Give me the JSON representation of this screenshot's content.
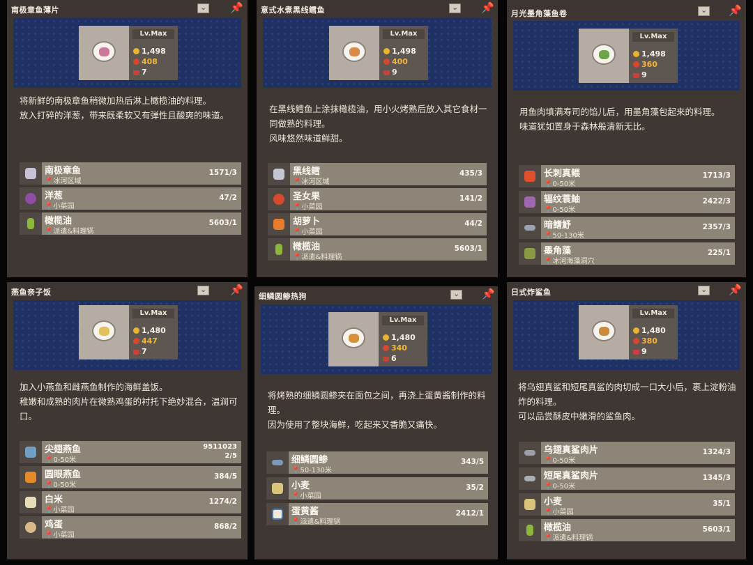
{
  "cards": [
    {
      "title": "南极章鱼薄片",
      "level": "Lv.Max",
      "price": "1,498",
      "score": "408",
      "time": "7",
      "description": "将新鲜的南极章鱼稍微加热后淋上橄榄油的料理。\n放入打碎的洋葱，带来既柔软又有弹性且酸爽的味道。",
      "ingredients": [
        {
          "name": "南极章鱼",
          "location": "冰河区域",
          "count": "1571/3"
        },
        {
          "name": "洋葱",
          "location": "小菜园",
          "count": "47/2"
        },
        {
          "name": "橄榄油",
          "location": "派遣&料理锅",
          "count": "5603/1"
        }
      ]
    },
    {
      "title": "意式水煮黑线鳕鱼",
      "level": "Lv.Max",
      "price": "1,498",
      "score": "400",
      "time": "9",
      "description": "在黑线鳕鱼上涂抹橄榄油，用小火烤熟后放入其它食材一同做熟的料理。\n风味悠然味道鲜甜。",
      "ingredients": [
        {
          "name": "黑线鳕",
          "location": "冰河区域",
          "count": "435/3"
        },
        {
          "name": "圣女果",
          "location": "小菜园",
          "count": "141/2"
        },
        {
          "name": "胡萝卜",
          "location": "小菜园",
          "count": "44/2"
        },
        {
          "name": "橄榄油",
          "location": "派遣&料理锅",
          "count": "5603/1"
        }
      ]
    },
    {
      "title": "月光墨角藻鱼卷",
      "level": "Lv.Max",
      "price": "1,498",
      "score": "360",
      "time": "9",
      "description": "用鱼肉填满寿司的馅儿后，用墨角藻包起来的料理。\n味道犹如置身于森林般清新无比。",
      "ingredients": [
        {
          "name": "长刺真鳂",
          "location": "0-50米",
          "count": "1713/3"
        },
        {
          "name": "辐纹蓑鲉",
          "location": "0-50米",
          "count": "2422/3"
        },
        {
          "name": "暗鳍魣",
          "location": "50-130米",
          "count": "2357/3"
        },
        {
          "name": "墨角藻",
          "location": "冰河海藻洞穴",
          "count": "225/1"
        }
      ]
    },
    {
      "title": "燕鱼亲子饭",
      "level": "Lv.Max",
      "price": "1,480",
      "score": "447",
      "time": "7",
      "description": "加入小燕鱼和雌燕鱼制作的海鲜盖饭。\n稚嫩和成熟的肉片在微熟鸡蛋的衬托下绝妙混合，温润可口。",
      "ingredients": [
        {
          "name": "尖翅燕鱼",
          "location": "0-50米",
          "count": "95110232/5"
        },
        {
          "name": "圆眼燕鱼",
          "location": "0-50米",
          "count": "384/5"
        },
        {
          "name": "白米",
          "location": "小菜园",
          "count": "1274/2"
        },
        {
          "name": "鸡蛋",
          "location": "小菜园",
          "count": "868/2"
        }
      ]
    },
    {
      "title": "细鳞圆鲹热狗",
      "level": "Lv.Max",
      "price": "1,480",
      "score": "340",
      "time": "6",
      "description": "将烤熟的细鳞圆鲹夹在面包之间，再浇上蛋黄酱制作的料理。\n因为使用了整块海鲜，吃起来又香脆又痛快。",
      "ingredients": [
        {
          "name": "细鳞圆鲹",
          "location": "50-130米",
          "count": "343/5"
        },
        {
          "name": "小麦",
          "location": "小菜园",
          "count": "35/2"
        },
        {
          "name": "蛋黄酱",
          "location": "派遣&料理锅",
          "count": "2412/1"
        }
      ]
    },
    {
      "title": "日式炸鲨鱼",
      "level": "Lv.Max",
      "price": "1,480",
      "score": "380",
      "time": "9",
      "description": "将乌翅真鲨和短尾真鲨的肉切成一口大小后，裹上淀粉油炸的料理。\n可以品尝酥皮中嫩滑的鲨鱼肉。",
      "ingredients": [
        {
          "name": "乌翅真鲨肉片",
          "location": "0-50米",
          "count": "1324/3"
        },
        {
          "name": "短尾真鲨肉片",
          "location": "0-50米",
          "count": "1345/3"
        },
        {
          "name": "小麦",
          "location": "小菜园",
          "count": "35/1"
        },
        {
          "name": "橄榄油",
          "location": "派遣&料理锅",
          "count": "5603/1"
        }
      ]
    }
  ],
  "colors": {
    "banner": "#1f3063",
    "score": "#f2b63a",
    "pin": "#e7962c"
  }
}
